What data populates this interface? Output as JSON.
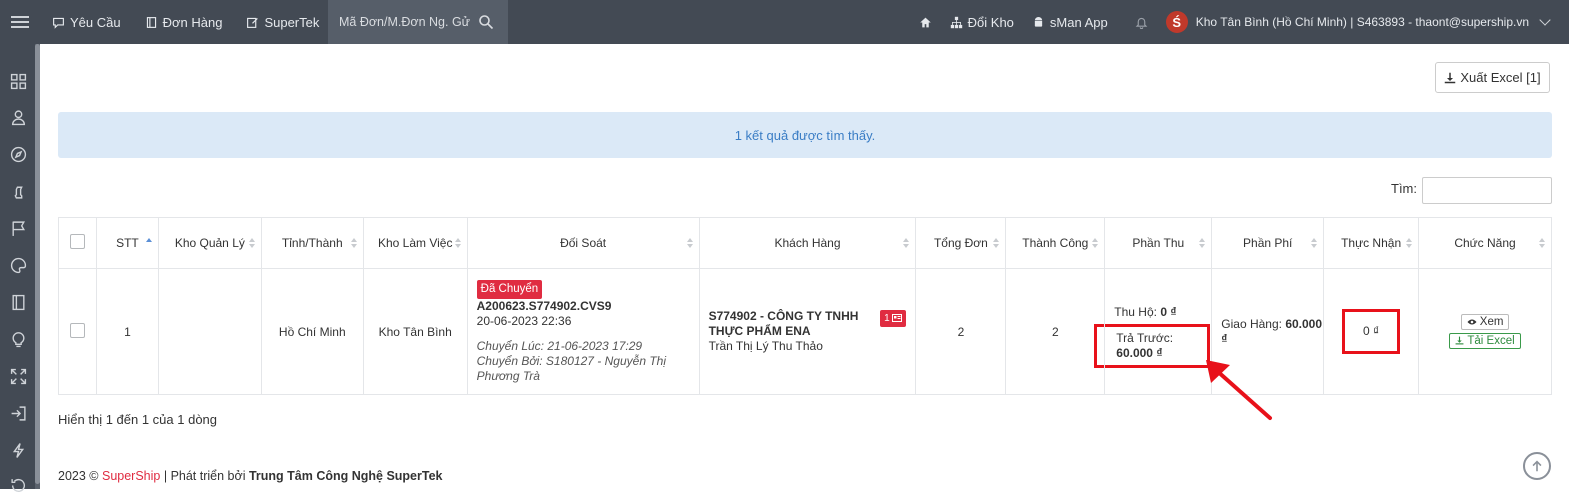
{
  "topnav": {
    "items": [
      {
        "label": "Yêu Cầu",
        "icon": "chat-icon"
      },
      {
        "label": "Đơn Hàng",
        "icon": "book-icon"
      },
      {
        "label": "SuperTek",
        "icon": "edit-icon"
      }
    ],
    "search_placeholder": "Mã Đơn/M.Đơn Ng. Gử",
    "right": {
      "home_icon": "home-icon",
      "switch_label": "Đổi Kho",
      "app_label": "sMan App",
      "logo_letter": "Ś",
      "user_text": "Kho Tân Bình (Hồ Chí Minh) | S463893 - thaont@supership.vn"
    }
  },
  "toolbar": {
    "export_label": "Xuất Excel [1]"
  },
  "alert_text": "1 kết quả được tìm thấy.",
  "search": {
    "label": "Tìm:"
  },
  "table": {
    "headers": [
      "STT",
      "Kho Quản Lý",
      "Tỉnh/Thành",
      "Kho Làm Việc",
      "Đối Soát",
      "Khách Hàng",
      "Tổng Đơn",
      "Thành Công",
      "Phần Thu",
      "Phần Phí",
      "Thực Nhận",
      "Chức Năng"
    ],
    "row": {
      "stt": "1",
      "kho_quan_ly": "",
      "tinh_thanh": "Hồ Chí Minh",
      "kho_lam_viec": "Kho Tân Bình",
      "doi_soat": {
        "status": "Đã Chuyển",
        "code": "A200623.S774902.CVS9",
        "date": "20-06-2023 22:36",
        "transfer_time": "Chuyển Lúc: 21-06-2023 17:29",
        "transfer_by": "Chuyển Bởi: S180127 - Nguyễn Thị Phương Trà"
      },
      "khach_hang": {
        "name": "S774902 - CÔNG TY TNHH THỰC PHẨM ENA",
        "contact": "Trần Thị Lý Thu Thảo",
        "badge": "1"
      },
      "tong_don": "2",
      "thanh_cong": "2",
      "phan_thu": {
        "thu_ho_label": "Thu Hộ:",
        "thu_ho_value": "0 ₫",
        "tra_truoc_label": "Trả Trước:",
        "tra_truoc_value": "60.000 ₫"
      },
      "phan_phi": {
        "giao_hang_label": "Giao Hàng:",
        "giao_hang_value": "60.000 ₫"
      },
      "thuc_nhan": "0 ₫",
      "actions": {
        "view": "Xem",
        "download": "Tải Excel"
      }
    }
  },
  "footer": {
    "paging": "Hiển thị 1 đến 1 của 1 dòng",
    "copyright_prefix": "2023 ©",
    "brand": "SuperShip",
    "dev_prefix": "| Phát triển bởi",
    "dev_name": "Trung Tâm Công Nghệ SuperTek"
  },
  "colors": {
    "topbar": "#434a54",
    "alert_bg": "#dbe9f7",
    "highlight": "#e8111a",
    "badge": "#e02c41"
  }
}
